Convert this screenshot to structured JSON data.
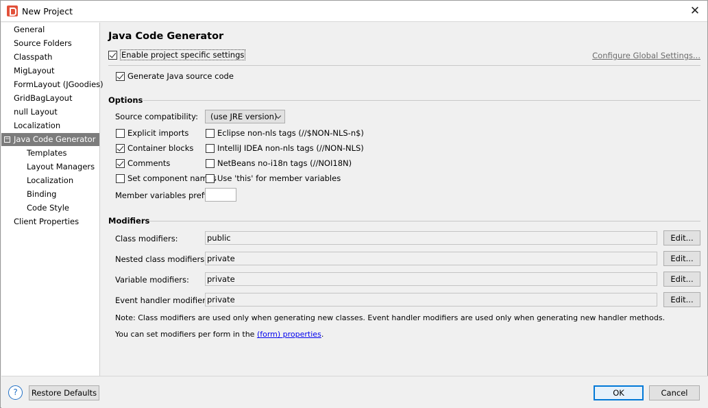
{
  "window": {
    "title": "New Project",
    "close_symbol": "✕"
  },
  "sidebar": {
    "items": [
      {
        "label": "General",
        "level": 0
      },
      {
        "label": "Source Folders",
        "level": 0
      },
      {
        "label": "Classpath",
        "level": 0
      },
      {
        "label": "MigLayout",
        "level": 0
      },
      {
        "label": "FormLayout (JGoodies)",
        "level": 0
      },
      {
        "label": "GridBagLayout",
        "level": 0
      },
      {
        "label": "null Layout",
        "level": 0
      },
      {
        "label": "Localization",
        "level": 0
      },
      {
        "label": "Java Code Generator",
        "level": 0,
        "selected": true,
        "toggle": "−"
      },
      {
        "label": "Templates",
        "level": 1
      },
      {
        "label": "Layout Managers",
        "level": 1
      },
      {
        "label": "Localization",
        "level": 1
      },
      {
        "label": "Binding",
        "level": 1
      },
      {
        "label": "Code Style",
        "level": 1
      },
      {
        "label": "Client Properties",
        "level": 0
      }
    ]
  },
  "main": {
    "title": "Java Code Generator",
    "enable_specific": {
      "label": "Enable project specific settings",
      "checked": true
    },
    "configure_global": "Configure Global Settings...",
    "generate_source": {
      "label": "Generate Java source code",
      "checked": true
    },
    "options": {
      "title": "Options",
      "source_compat_label": "Source compatibility:",
      "source_compat_value": "(use JRE version)",
      "left_checks": [
        {
          "label": "Explicit imports",
          "checked": false
        },
        {
          "label": "Container blocks",
          "checked": true
        },
        {
          "label": "Comments",
          "checked": true
        },
        {
          "label": "Set component names",
          "checked": false
        }
      ],
      "right_checks": [
        {
          "label": "Eclipse non-nls tags (//$NON-NLS-n$)",
          "checked": false
        },
        {
          "label": "IntelliJ IDEA non-nls tags (//NON-NLS)",
          "checked": false
        },
        {
          "label": "NetBeans no-i18n tags (//NOI18N)",
          "checked": false
        },
        {
          "label": "Use 'this' for member variables",
          "checked": false
        }
      ],
      "member_prefix_label": "Member variables prefix:",
      "member_prefix_value": ""
    },
    "modifiers": {
      "title": "Modifiers",
      "rows": [
        {
          "label": "Class modifiers:",
          "value": "public",
          "button": "Edit..."
        },
        {
          "label": "Nested class modifiers:",
          "value": "private",
          "button": "Edit..."
        },
        {
          "label": "Variable modifiers:",
          "value": "private",
          "button": "Edit..."
        },
        {
          "label": "Event handler modifiers:",
          "value": "private",
          "button": "Edit..."
        }
      ],
      "note": "Note: Class modifiers are used only when generating new classes. Event handler modifiers are used only when generating new handler methods.",
      "per_form_prefix": "You can set modifiers per form in the ",
      "per_form_link": "(form) properties",
      "per_form_suffix": "."
    }
  },
  "footer": {
    "help_symbol": "?",
    "restore_defaults": "Restore Defaults",
    "ok": "OK",
    "cancel": "Cancel"
  }
}
